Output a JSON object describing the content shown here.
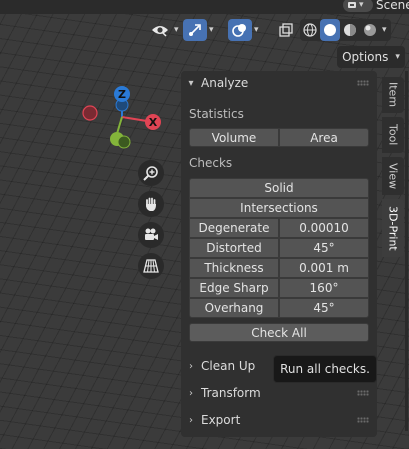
{
  "header": {
    "scene_label": "Scene",
    "options_label": "Options"
  },
  "colors": {
    "accent_blue": "#4772b3",
    "axis_x": "#e04454",
    "axis_y": "#83b43a",
    "axis_z": "#2a7ad6"
  },
  "gizmo": {
    "z_label": "Z",
    "x_label": "X"
  },
  "icons": {
    "view": "eye-icon",
    "gizmo": "gizmo-arrows-icon",
    "overlay": "overlay-icon",
    "xray": "xray-icon",
    "wireframe": "wireframe-sphere-icon",
    "solid": "solid-sphere-icon",
    "material": "material-sphere-icon",
    "rendered": "rendered-sphere-icon",
    "zoom": "zoom-icon",
    "pan": "hand-icon",
    "camera": "camera-icon",
    "ortho": "grid-icon"
  },
  "panel": {
    "analyze": {
      "title": "Analyze",
      "statistics_label": "Statistics",
      "volume_button": "Volume",
      "area_button": "Area",
      "checks_label": "Checks",
      "solid_button": "Solid",
      "intersections_button": "Intersections",
      "rows": [
        {
          "label": "Degenerate",
          "value": "0.00010"
        },
        {
          "label": "Distorted",
          "value": "45°"
        },
        {
          "label": "Thickness",
          "value": "0.001 m"
        },
        {
          "label": "Edge Sharp",
          "value": "160°"
        },
        {
          "label": "Overhang",
          "value": "45°"
        }
      ],
      "check_all_button": "Check All"
    },
    "clean_up": {
      "title": "Clean Up"
    },
    "transform": {
      "title": "Transform"
    },
    "export": {
      "title": "Export"
    }
  },
  "tabs": [
    {
      "label": "Item"
    },
    {
      "label": "Tool"
    },
    {
      "label": "View"
    },
    {
      "label": "3D-Print"
    }
  ],
  "tooltip": {
    "text": "Run all checks."
  }
}
